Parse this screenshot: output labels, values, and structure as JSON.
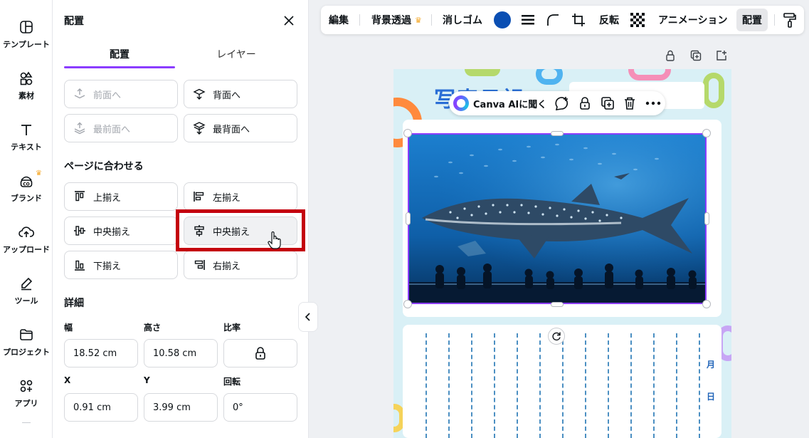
{
  "sidebar": {
    "items": [
      {
        "label": "テンプレート",
        "icon": "template-icon"
      },
      {
        "label": "素材",
        "icon": "elements-icon"
      },
      {
        "label": "テキスト",
        "icon": "text-icon"
      },
      {
        "label": "ブランド",
        "icon": "brand-icon"
      },
      {
        "label": "アップロード",
        "icon": "upload-icon"
      },
      {
        "label": "ツール",
        "icon": "tools-icon"
      },
      {
        "label": "プロジェクト",
        "icon": "folder-icon"
      },
      {
        "label": "アプリ",
        "icon": "apps-icon"
      }
    ]
  },
  "panel": {
    "title": "配置",
    "tabs": [
      "配置",
      "レイヤー"
    ],
    "order_buttons": [
      "前面へ",
      "背面へ",
      "最前面へ",
      "最背面へ"
    ],
    "align_title": "ページに合わせる",
    "align_buttons": [
      "上揃え",
      "左揃え",
      "中央揃え",
      "中央揃え",
      "下揃え",
      "右揃え"
    ],
    "detail_title": "詳細",
    "fields": {
      "width_label": "幅",
      "width": "18.52 cm",
      "height_label": "高さ",
      "height": "10.58 cm",
      "ratio_label": "比率",
      "x_label": "X",
      "x": "0.91 cm",
      "y_label": "Y",
      "y": "3.99 cm",
      "rotate_label": "回転",
      "rotate": "0°"
    }
  },
  "toolbar": {
    "items": [
      "編集",
      "背景透過",
      "消しゴム",
      "反転",
      "アニメーション",
      "配置"
    ],
    "color": "#0b4fb3"
  },
  "float_bar": {
    "ai_label": "Canva AIに聞く"
  },
  "canvas": {
    "title": "写真日記",
    "dates": [
      "月",
      "日"
    ]
  },
  "colors": {
    "accent": "#8b3dff",
    "highlight": "#c4000d"
  }
}
